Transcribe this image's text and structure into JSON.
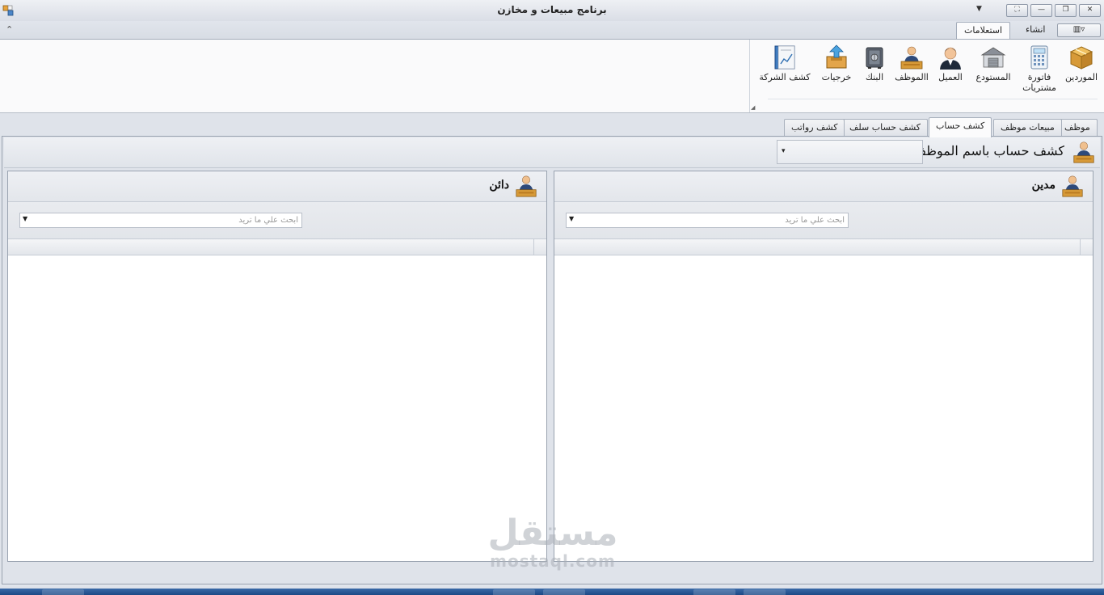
{
  "window": {
    "title": "برنامج مبيعات و مخازن",
    "qat_arrow": "▼",
    "buttons": {
      "fullscreen": "⛶",
      "minimize": "—",
      "restore": "❐",
      "close": "✕"
    }
  },
  "ribbon": {
    "collapse_glyph": "⌃",
    "view_glyph": "▥▿",
    "tabs": [
      {
        "label": "استعلامات",
        "active": true
      },
      {
        "label": "انشاء",
        "active": false
      }
    ],
    "buttons": [
      {
        "label": "الموردين",
        "icon": "box-icon"
      },
      {
        "label": "فاتورة مشتريات",
        "icon": "calculator-icon"
      },
      {
        "label": "المستودع",
        "icon": "warehouse-icon"
      },
      {
        "label": "العميل",
        "icon": "customer-icon"
      },
      {
        "label": "االموظف",
        "icon": "employee-icon"
      },
      {
        "label": "البنك",
        "icon": "safe-icon"
      },
      {
        "label": "خرجيات",
        "icon": "outbox-icon"
      },
      {
        "label": "كشف الشركة",
        "icon": "report-icon"
      }
    ],
    "group_launcher": "◢"
  },
  "main_tabs": [
    {
      "label": "موظف",
      "active": false
    },
    {
      "label": "مبيعات موظف",
      "active": false
    },
    {
      "label": "كشف حساب",
      "active": true
    },
    {
      "label": "كشف حساب سلف",
      "active": false
    },
    {
      "label": "كشف رواتب",
      "active": false
    }
  ],
  "statement": {
    "title": "كشف حساب باسم الموظف",
    "employee_combo_value": "",
    "combo_arrow": "▾"
  },
  "debit_panel": {
    "title": "مدين",
    "search_placeholder": "ابحث علي ما تريد",
    "search_value": "",
    "combo_arrow": "▼"
  },
  "credit_panel": {
    "title": "دائن",
    "search_placeholder": "ابحث علي ما تريد",
    "search_value": "",
    "combo_arrow": "▼"
  },
  "watermark": {
    "arabic": "مستقل",
    "latin": "mostaql.com"
  },
  "colors": {
    "accent": "#3a6aa8",
    "ribbon_bg": "#fafafb",
    "frame_bg": "#dfe3ea"
  }
}
